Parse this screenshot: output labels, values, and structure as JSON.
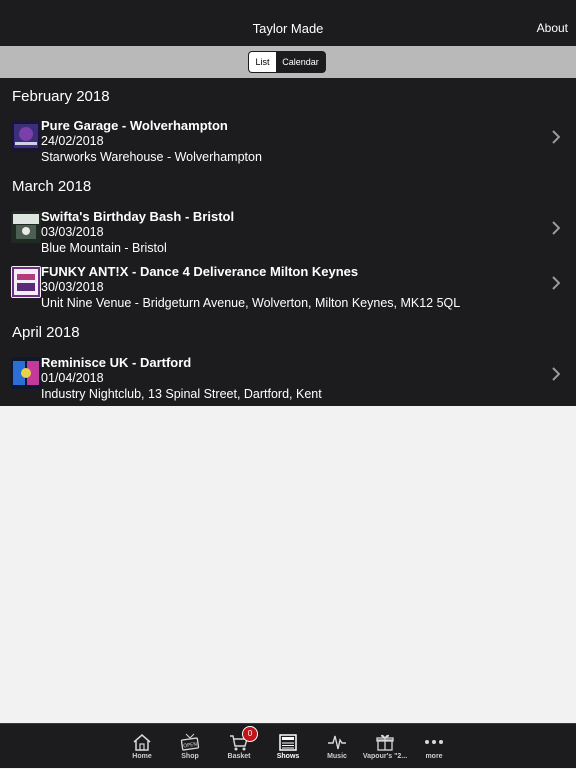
{
  "navbar": {
    "title": "Taylor Made",
    "about_label": "About"
  },
  "segmented": {
    "list_label": "List",
    "calendar_label": "Calendar",
    "selected": "List"
  },
  "months": [
    {
      "label": "February 2018",
      "events": [
        {
          "title": "Pure Garage - Wolverhampton",
          "date": "24/02/2018",
          "venue": "Starworks Warehouse - Wolverhampton"
        }
      ]
    },
    {
      "label": "March 2018",
      "events": [
        {
          "title": "Swifta's Birthday Bash - Bristol",
          "date": "03/03/2018",
          "venue": "Blue Mountain - Bristol"
        },
        {
          "title": "FUNKY ANT!X - Dance 4 Deliverance Milton Keynes",
          "date": "30/03/2018",
          "venue": "Unit Nine Venue - Bridgeturn Avenue, Wolverton, Milton Keynes, MK12 5QL"
        }
      ]
    },
    {
      "label": "April 2018",
      "events": [
        {
          "title": "Reminisce UK - Dartford",
          "date": "01/04/2018",
          "venue": "Industry Nightclub, 13 Spinal Street, Dartford, Kent"
        }
      ]
    }
  ],
  "tabbar": {
    "items": [
      {
        "label": "Home",
        "icon": "home-icon"
      },
      {
        "label": "Shop",
        "icon": "open-sign-icon"
      },
      {
        "label": "Basket",
        "icon": "cart-icon",
        "badge": "0"
      },
      {
        "label": "Shows",
        "icon": "newspaper-icon",
        "active": true
      },
      {
        "label": "Music",
        "icon": "waveform-icon"
      },
      {
        "label": "Vapour's \"2...",
        "icon": "gift-icon"
      },
      {
        "label": "more",
        "icon": "more-dots-icon"
      }
    ]
  },
  "colors": {
    "bar": "#1c1c1e",
    "segment_bg": "#b9b9b9",
    "page_bg": "#f2f2f2",
    "badge": "#c0151b"
  }
}
